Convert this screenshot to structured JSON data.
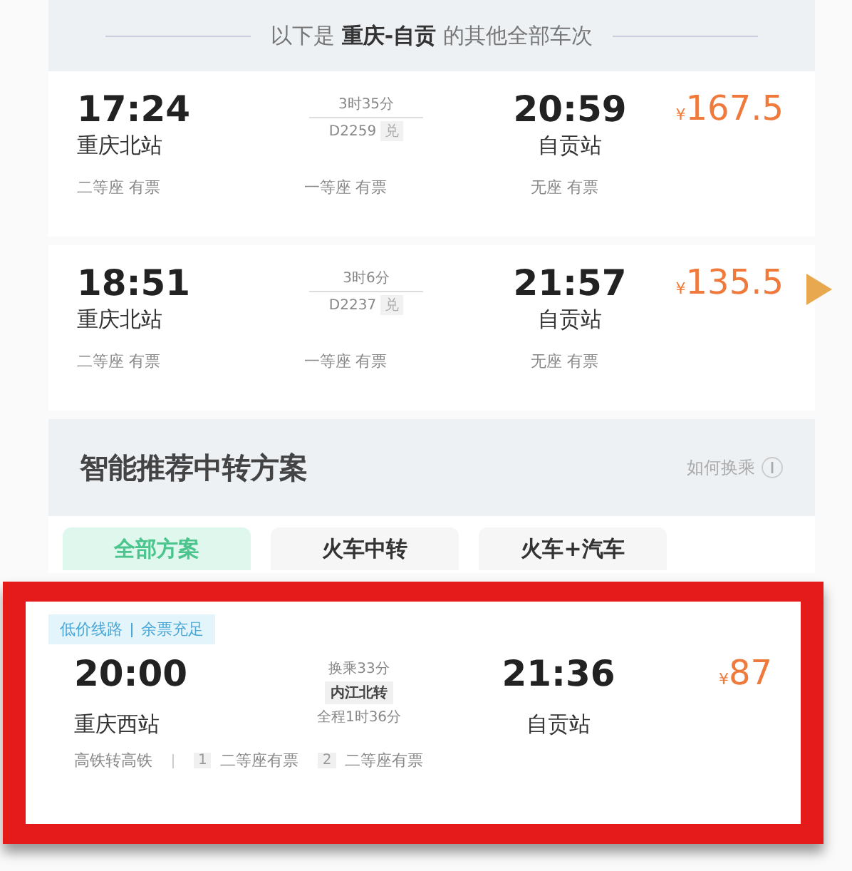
{
  "banner": {
    "prefix": "以下是",
    "route": "重庆-自贡",
    "suffix": "的其他全部车次"
  },
  "trains": [
    {
      "depart_time": "17:24",
      "depart_station": "重庆北站",
      "duration": "3时35分",
      "train_no": "D2259",
      "badge": "兑",
      "arrive_time": "20:59",
      "arrive_station": "自贡站",
      "currency": "¥",
      "price": "167.5",
      "seats": [
        "二等座 有票",
        "一等座 有票",
        "无座 有票"
      ]
    },
    {
      "depart_time": "18:51",
      "depart_station": "重庆北站",
      "duration": "3时6分",
      "train_no": "D2237",
      "badge": "兑",
      "arrive_time": "21:57",
      "arrive_station": "自贡站",
      "currency": "¥",
      "price": "135.5",
      "seats": [
        "二等座 有票",
        "一等座 有票",
        "无座 有票"
      ]
    }
  ],
  "transfer_section": {
    "title": "智能推荐中转方案",
    "help": "如何换乘"
  },
  "tabs": [
    {
      "label": "全部方案",
      "selected": true
    },
    {
      "label": "火车中转",
      "selected": false
    },
    {
      "label": "火车+汽车",
      "selected": false
    }
  ],
  "transfer_card": {
    "highlighted": true,
    "tags": [
      "低价线路",
      "余票充足"
    ],
    "depart_time": "20:00",
    "depart_station": "重庆西站",
    "wait": "换乘33分",
    "via": "内江北转",
    "total": "全程1时36分",
    "arrive_time": "21:36",
    "arrive_station": "自贡站",
    "currency": "¥",
    "price": "87",
    "mode": "高铁转高铁",
    "legs": [
      {
        "index": "1",
        "seat": "二等座有票"
      },
      {
        "index": "2",
        "seat": "二等座有票"
      }
    ]
  }
}
